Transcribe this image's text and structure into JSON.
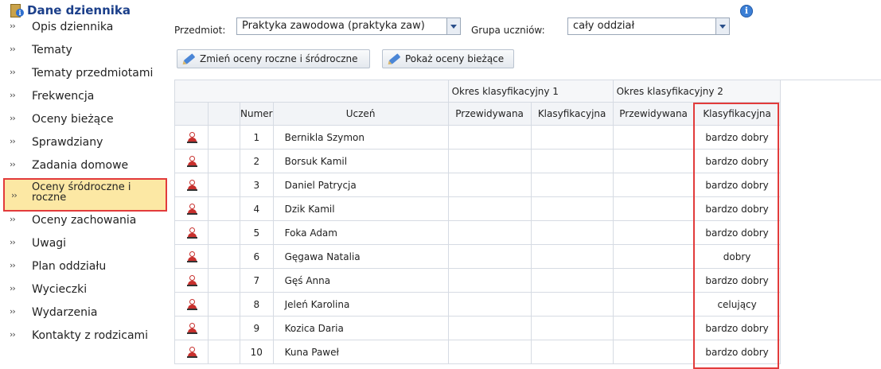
{
  "sidebar": {
    "title": "Dane dziennika",
    "items": [
      {
        "label": "Opis dziennika"
      },
      {
        "label": "Tematy"
      },
      {
        "label": "Tematy przedmiotami"
      },
      {
        "label": "Frekwencja"
      },
      {
        "label": "Oceny bieżące"
      },
      {
        "label": "Sprawdziany"
      },
      {
        "label": "Zadania domowe"
      },
      {
        "label": "Oceny śródroczne i roczne",
        "active": true
      },
      {
        "label": "Oceny zachowania"
      },
      {
        "label": "Uwagi"
      },
      {
        "label": "Plan oddziału"
      },
      {
        "label": "Wycieczki"
      },
      {
        "label": "Wydarzenia"
      },
      {
        "label": "Kontakty z rodzicami"
      }
    ],
    "arrow": "››"
  },
  "filters": {
    "subject_label": "Przedmiot:",
    "subject_value": "Praktyka zawodowa (praktyka zaw)",
    "group_label": "Grupa uczniów:",
    "group_value": "cały oddział",
    "info_icon": "info-icon"
  },
  "toolbar": {
    "change_label": "Zmień oceny roczne i śródroczne",
    "show_label": "Pokaż oceny bieżące"
  },
  "table": {
    "period1": "Okres klasyfikacyjny 1",
    "period2": "Okres klasyfikacyjny 2",
    "headers": {
      "numer": "Numer",
      "uczen": "Uczeń",
      "p1_pred": "Przewidywana",
      "p1_klas": "Klasyfikacyjna",
      "p2_pred": "Przewidywana",
      "p2_klas": "Klasyfikacyjna"
    },
    "rows": [
      {
        "num": "1",
        "name": "Bernikla Szymon",
        "p1_pred": "",
        "p1_klas": "",
        "p2_pred": "",
        "p2_klas": "bardzo dobry"
      },
      {
        "num": "2",
        "name": "Borsuk Kamil",
        "p1_pred": "",
        "p1_klas": "",
        "p2_pred": "",
        "p2_klas": "bardzo dobry"
      },
      {
        "num": "3",
        "name": "Daniel Patrycja",
        "p1_pred": "",
        "p1_klas": "",
        "p2_pred": "",
        "p2_klas": "bardzo dobry"
      },
      {
        "num": "4",
        "name": "Dzik Kamil",
        "p1_pred": "",
        "p1_klas": "",
        "p2_pred": "",
        "p2_klas": "bardzo dobry"
      },
      {
        "num": "5",
        "name": "Foka Adam",
        "p1_pred": "",
        "p1_klas": "",
        "p2_pred": "",
        "p2_klas": "bardzo dobry"
      },
      {
        "num": "6",
        "name": "Gęgawa Natalia",
        "p1_pred": "",
        "p1_klas": "",
        "p2_pred": "",
        "p2_klas": "dobry"
      },
      {
        "num": "7",
        "name": "Gęś Anna",
        "p1_pred": "",
        "p1_klas": "",
        "p2_pred": "",
        "p2_klas": "bardzo dobry"
      },
      {
        "num": "8",
        "name": "Jeleń Karolina",
        "p1_pred": "",
        "p1_klas": "",
        "p2_pred": "",
        "p2_klas": "celujący"
      },
      {
        "num": "9",
        "name": "Kozica Daria",
        "p1_pred": "",
        "p1_klas": "",
        "p2_pred": "",
        "p2_klas": "bardzo dobry"
      },
      {
        "num": "10",
        "name": "Kuna Paweł",
        "p1_pred": "",
        "p1_klas": "",
        "p2_pred": "",
        "p2_klas": "bardzo dobry"
      }
    ]
  },
  "colors": {
    "highlight_border": "#e23b3b",
    "active_bg": "#fce8a4",
    "title": "#1b3f8a",
    "student_icon": "#c8302d"
  }
}
